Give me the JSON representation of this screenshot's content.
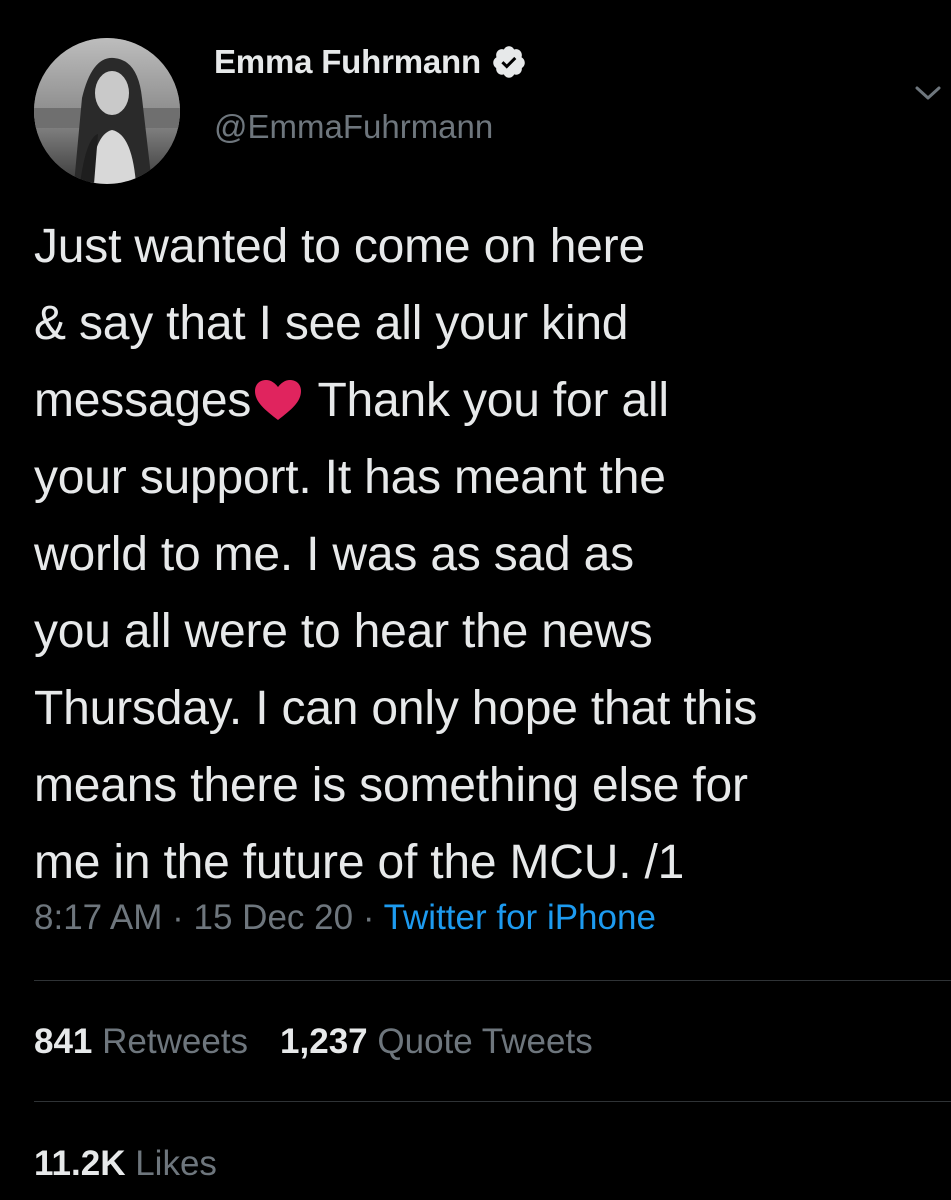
{
  "tweet": {
    "author": {
      "display_name": "Emma Fuhrmann",
      "handle": "@EmmaFuhrmann",
      "verified": true
    },
    "icons": {
      "avatar": "profile-photo",
      "verified": "verified-badge-icon",
      "menu": "chevron-down-icon",
      "emoji": "red-heart"
    },
    "text_lines": [
      "Just wanted to come on here",
      "& say that I see all your kind",
      "messages",
      " Thank you for all",
      "your support. It has meant the",
      "world to me. I was as sad as",
      "you all were to hear the news",
      "Thursday. I can only hope that this",
      "means there is something else for",
      "me in the future of the MCU. /1"
    ],
    "meta": {
      "time": "8:17 AM",
      "separator": " · ",
      "date": "15 Dec 20",
      "source": "Twitter for iPhone"
    },
    "stats": {
      "retweets_count": "841",
      "retweets_label": "Retweets",
      "quote_tweets_count": "1,237",
      "quote_tweets_label": "Quote Tweets",
      "likes_count": "11.2K",
      "likes_label": "Likes"
    }
  },
  "colors": {
    "background": "#000000",
    "primary_text": "#e7e9ea",
    "secondary_text": "#6e767d",
    "link": "#1d9bf0",
    "divider": "#2f3336",
    "heart": "#e0245e"
  }
}
